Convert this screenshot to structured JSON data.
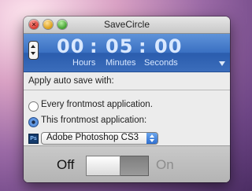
{
  "window": {
    "title": "SaveCircle"
  },
  "timer": {
    "hours": "00",
    "minutes": "05",
    "seconds": "00",
    "separator": ":",
    "units": {
      "hours": "Hours",
      "minutes": "Minutes",
      "seconds": "Seconds"
    }
  },
  "options": {
    "apply_label": "Apply auto save with:",
    "radios": [
      {
        "label": "Every frontmost application.",
        "selected": false
      },
      {
        "label": "This frontmost application:",
        "selected": true
      }
    ],
    "app_popup": {
      "icon_text": "Ps",
      "selected": "Adobe Photoshop CS3"
    }
  },
  "toggle": {
    "off_label": "Off",
    "on_label": "On",
    "state": "off"
  },
  "colors": {
    "timer_bar": "#3a70c2",
    "timer_text": "#d9e8ff"
  }
}
